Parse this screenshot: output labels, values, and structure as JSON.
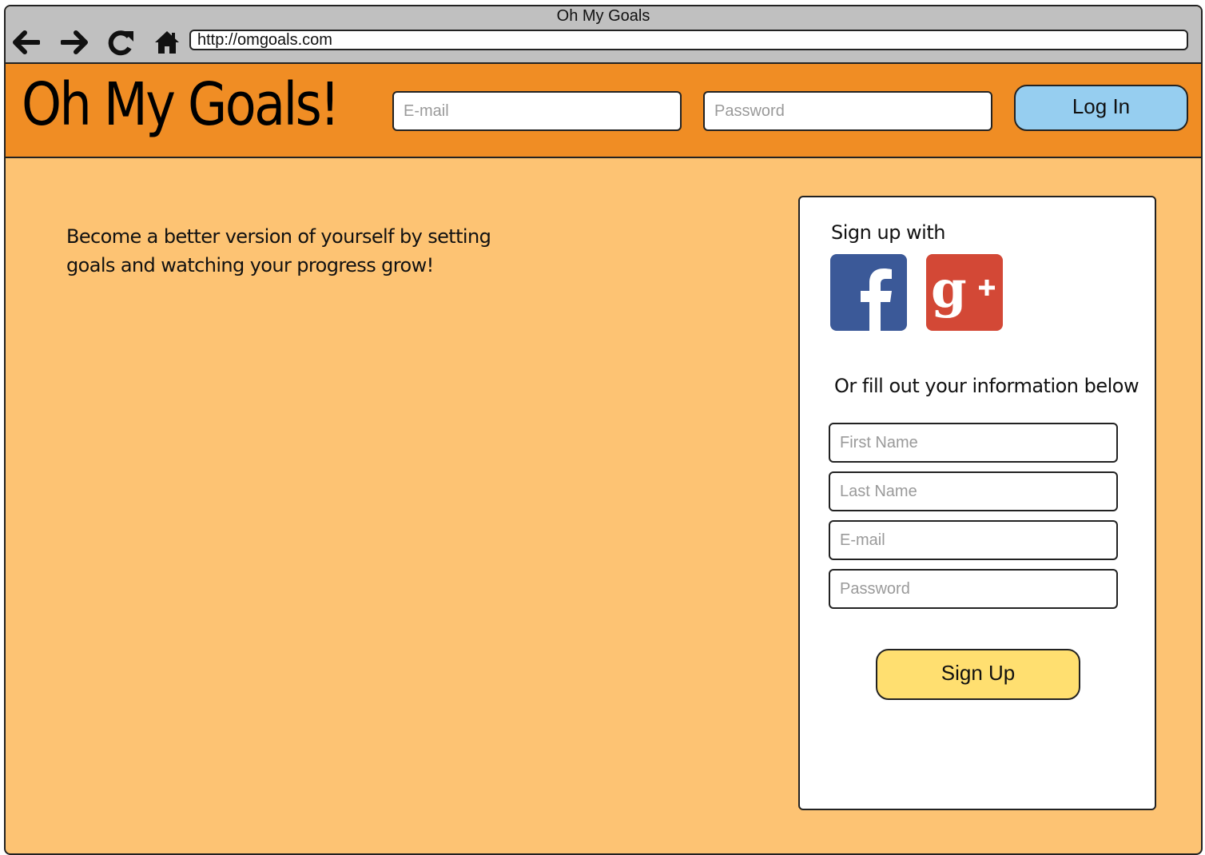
{
  "browser": {
    "window_title": "Oh My Goals",
    "url": "http://omgoals.com",
    "nav_icons": [
      "back-arrow-icon",
      "forward-arrow-icon",
      "reload-icon",
      "home-icon"
    ]
  },
  "header": {
    "logo": "Oh My Goals!",
    "email_placeholder": "E-mail",
    "password_placeholder": "Password",
    "login_label": "Log In"
  },
  "main": {
    "tagline": "Become a better version of yourself by setting goals and watching your progress grow!"
  },
  "signup": {
    "social_heading": "Sign up with",
    "social_icons": [
      "facebook-icon",
      "google-plus-icon"
    ],
    "form_heading": "Or fill out your information below",
    "first_name_placeholder": "First Name",
    "last_name_placeholder": "Last Name",
    "email_placeholder": "E-mail",
    "password_placeholder": "Password",
    "signup_label": "Sign Up"
  },
  "colors": {
    "header": "#F08D24",
    "page_background": "#FDC373",
    "login_button": "#96CEF0",
    "signup_button": "#FFDF70",
    "titlebar": "#C0C0C0",
    "facebook": "#3B5998",
    "google_plus": "#D34836"
  }
}
